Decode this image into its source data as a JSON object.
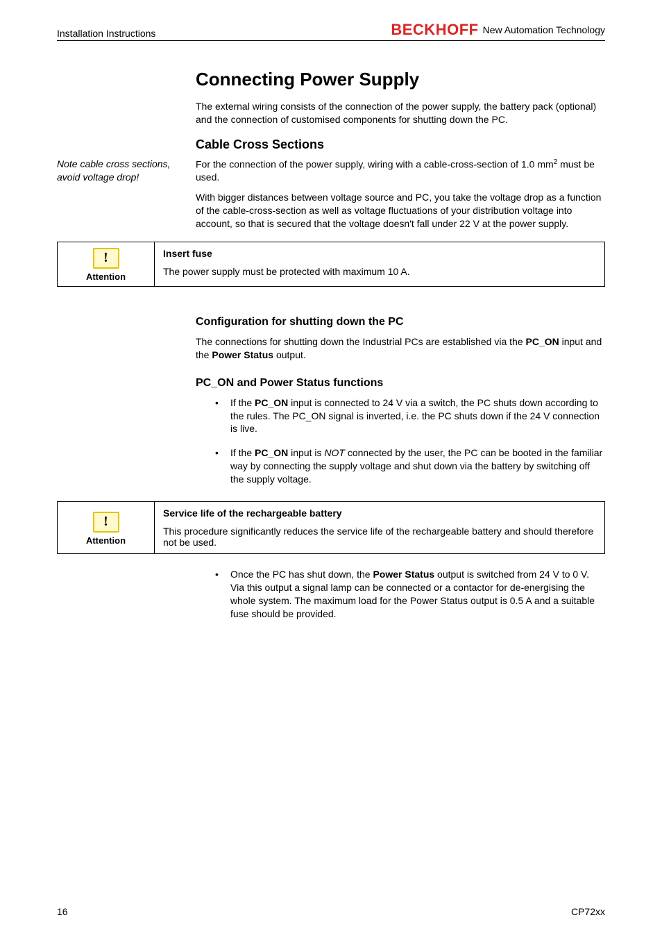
{
  "header": {
    "left": "Installation Instructions",
    "brand": "BECKHOFF",
    "brand_sub": "New Automation Technology"
  },
  "h1": "Connecting Power Supply",
  "intro": "The external wiring consists of the connection of the power supply, the battery pack (optional) and the connection of customised components for shutting down the PC.",
  "cable": {
    "heading": "Cable Cross Sections",
    "side_note": "Note cable cross sections, avoid voltage drop!",
    "p1a": "For the connection of the power supply, wiring  with a cable-cross-section of 1.0 mm",
    "p1_sup": "2",
    "p1b": "  must be used.",
    "p2": "With bigger distances between voltage source and PC, you take the voltage drop as a function of the cable-cross-section as well as voltage fluctuations of your distribution voltage into account, so that is secured that the voltage doesn't fall under 22 V at the power supply."
  },
  "attention1": {
    "label": "Attention",
    "title": "Insert fuse",
    "body": "The power supply must be protected with maximum 10 A."
  },
  "config": {
    "heading": "Configuration for shutting down the PC",
    "p1a": "The connections for shutting down the Industrial PCs are established via the ",
    "p1_b1": "PC_ON",
    "p1_mid": " input and the ",
    "p1_b2": "Power Status",
    "p1_end": " output."
  },
  "pcon": {
    "heading": "PC_ON and Power Status functions",
    "b1_a": "If the ",
    "b1_bold": "PC_ON",
    "b1_b": " input is connected to 24 V via a switch, the PC shuts down according to the rules. The PC_ON signal is inverted, i.e. the PC shuts down if the 24 V connection is live.",
    "b2_a": "If the ",
    "b2_bold": "PC_ON",
    "b2_b": " input is ",
    "b2_ital": "NOT",
    "b2_c": " connected by the user, the PC can be booted in the familiar way by connecting the supply voltage and shut down via the battery by switching off the supply voltage."
  },
  "attention2": {
    "label": "Attention",
    "title": "Service life of the rechargeable battery",
    "body": "This procedure significantly reduces the service life of the rechargeable battery and should therefore not be used."
  },
  "final_bullet": {
    "a": "Once the PC has shut down, the ",
    "bold": "Power Status",
    "b": " output is switched from 24 V to 0 V. Via this output a signal lamp can be connected or a contactor for de-energising the whole system. The maximum load for the Power Status output is 0.5 A and a suitable fuse should be provided."
  },
  "footer": {
    "page": "16",
    "doc": "CP72xx"
  }
}
